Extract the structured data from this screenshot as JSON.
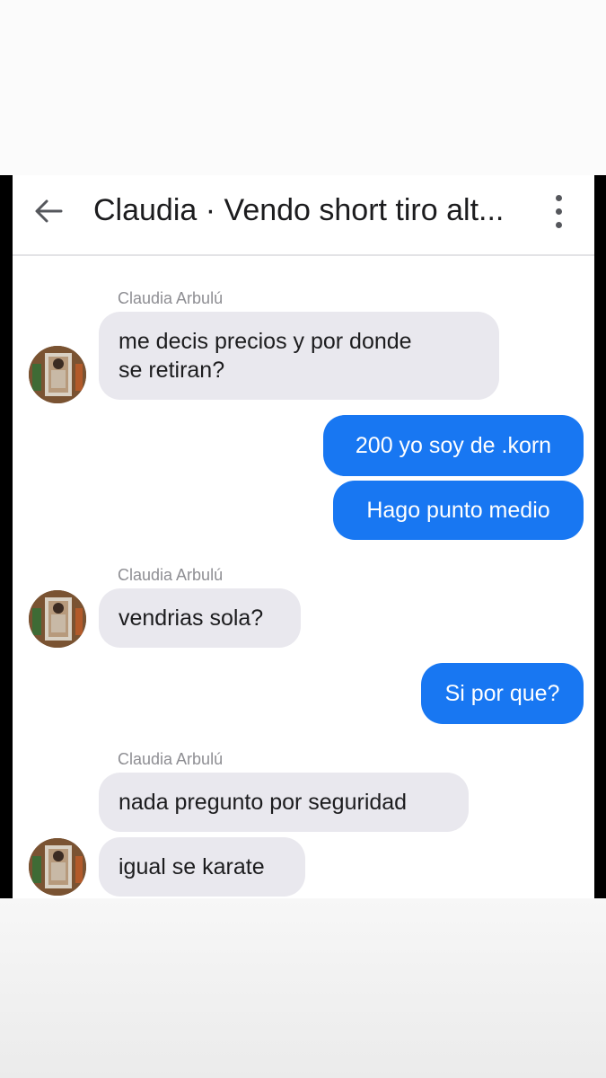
{
  "header": {
    "title": "Claudia · Vendo short tiro alt...",
    "back_icon": "arrow-left-icon",
    "menu_icon": "vertical-ellipsis-icon"
  },
  "colors": {
    "outgoing_bubble": "#1877f2",
    "incoming_bubble": "#e9e8ee",
    "sender_name": "#8e8e93"
  },
  "messages": [
    {
      "type": "name",
      "text": "Claudia Arbulú"
    },
    {
      "type": "incoming",
      "lines": [
        "me decis precios y por donde",
        "se retiran?"
      ]
    },
    {
      "type": "outgoing",
      "text": "200 yo soy de .korn"
    },
    {
      "type": "outgoing",
      "text": "Hago punto medio"
    },
    {
      "type": "name",
      "text": "Claudia Arbulú"
    },
    {
      "type": "incoming",
      "text": "vendrias sola?"
    },
    {
      "type": "outgoing",
      "text": "Si por que?"
    },
    {
      "type": "name",
      "text": "Claudia Arbulú"
    },
    {
      "type": "incoming",
      "text": "nada pregunto por seguridad"
    },
    {
      "type": "incoming",
      "text": "igual se karate"
    }
  ]
}
